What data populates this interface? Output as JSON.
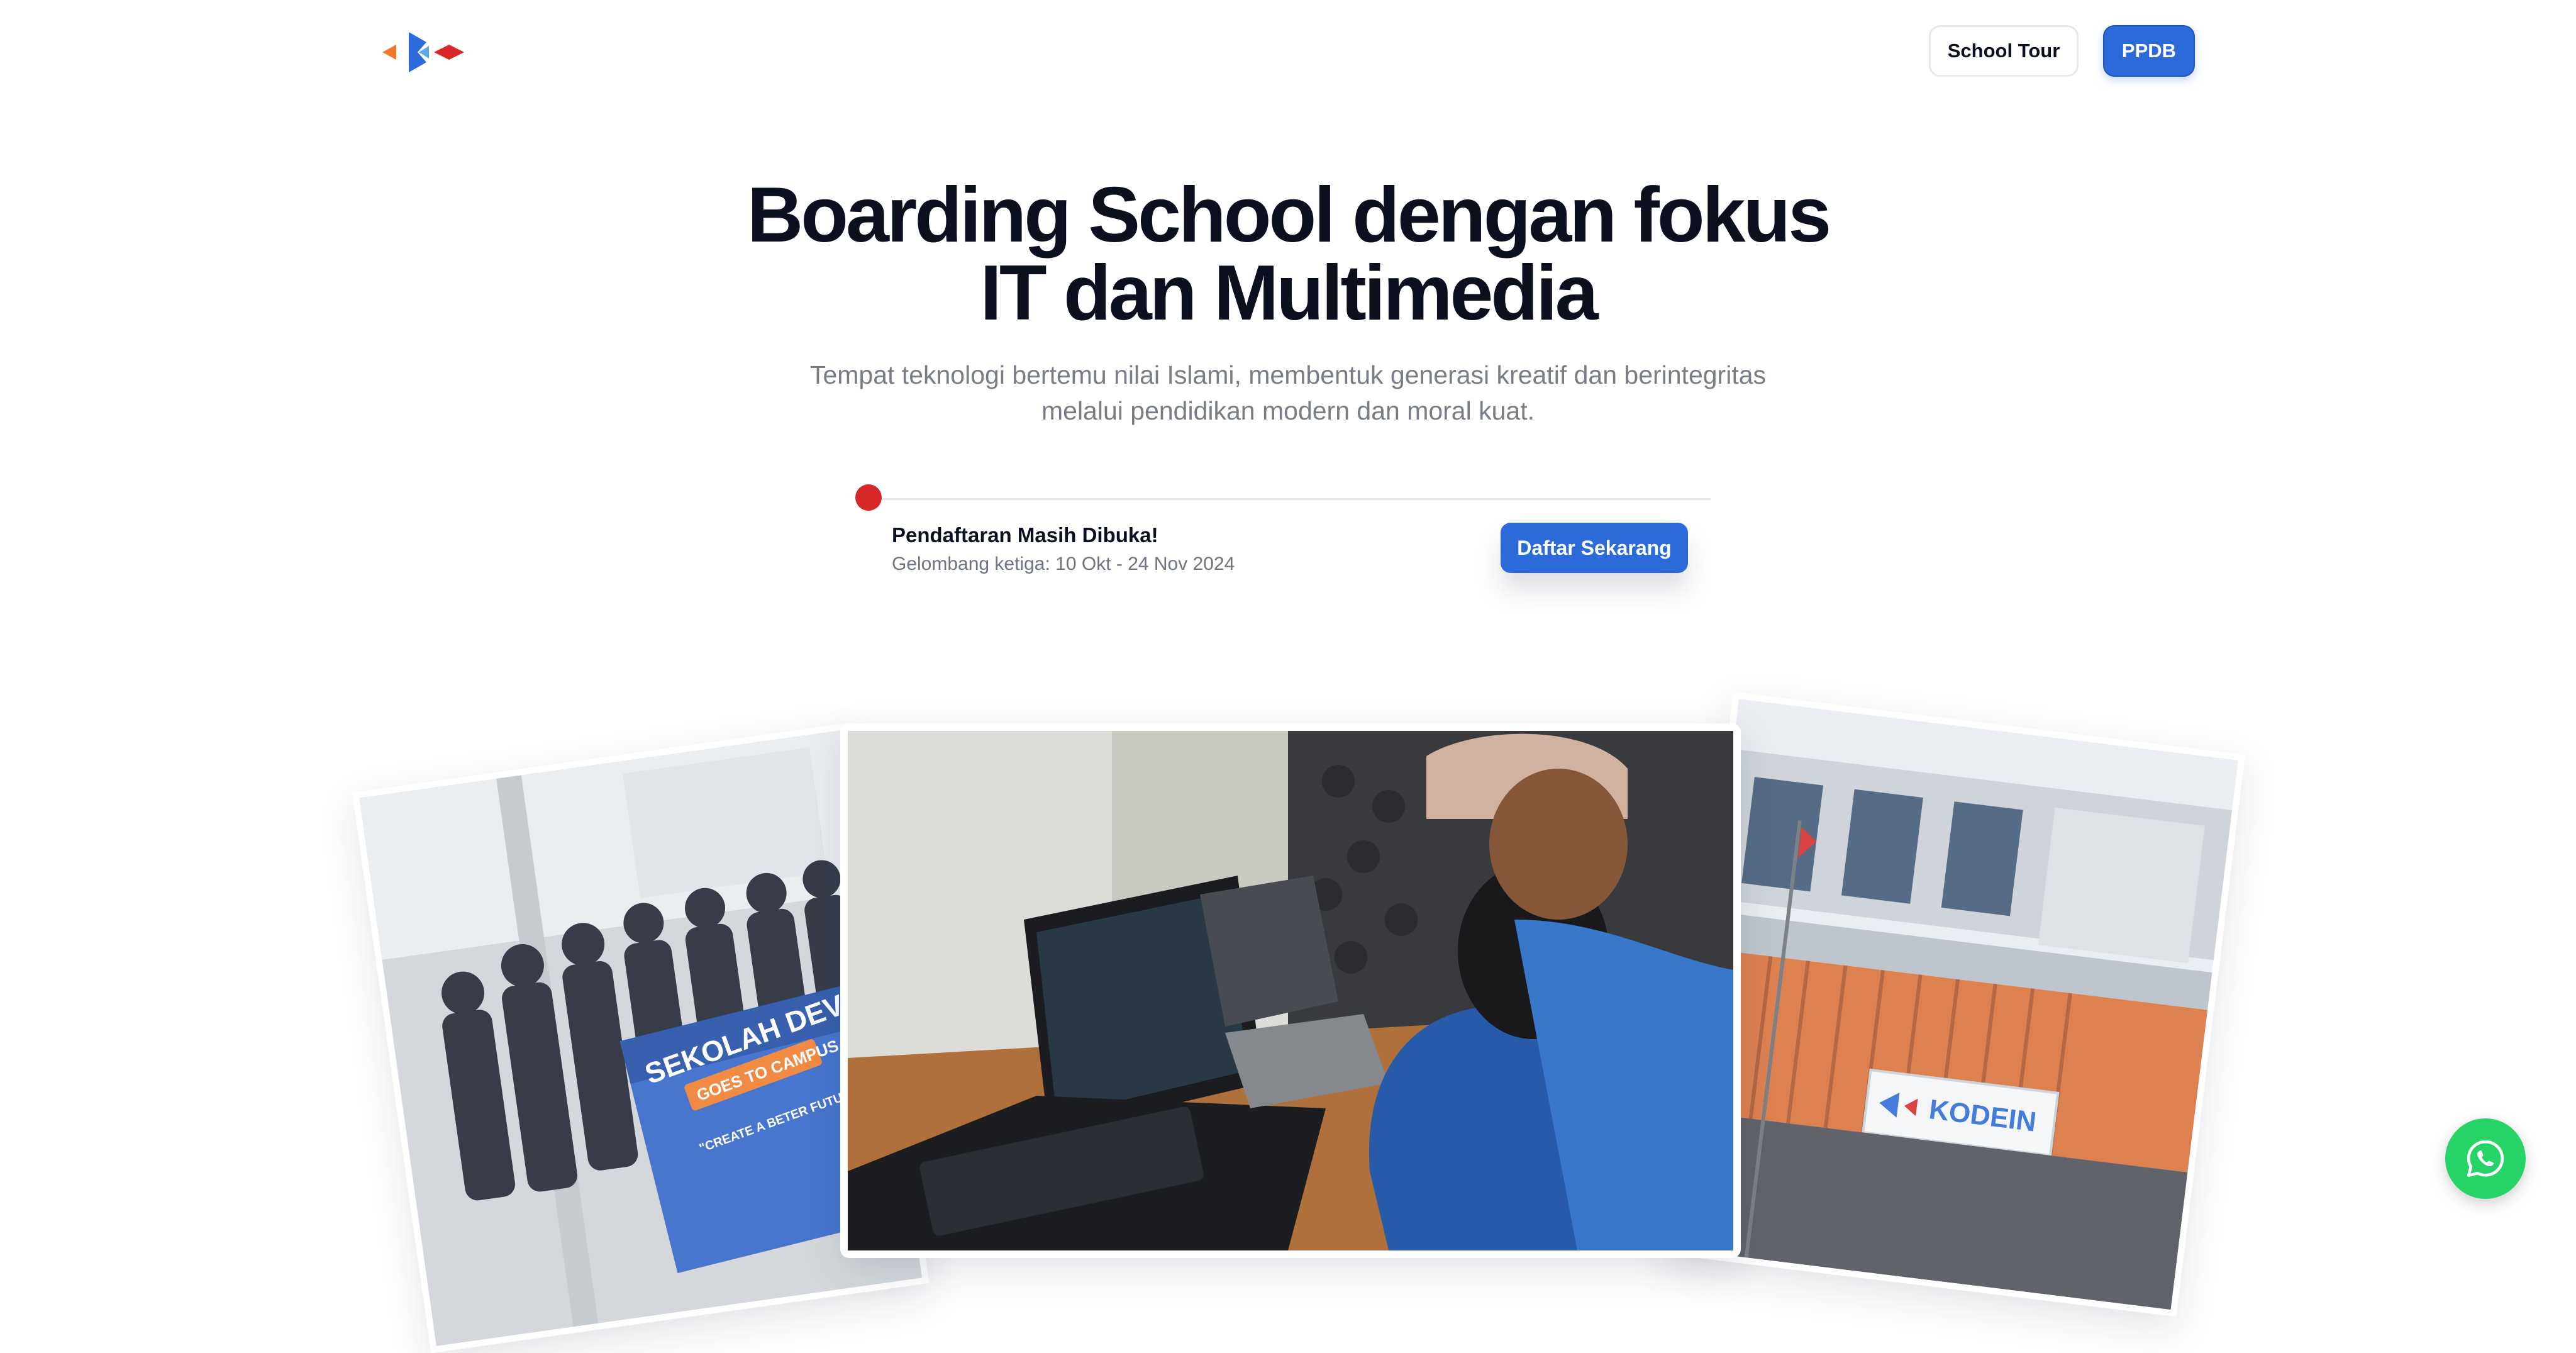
{
  "header": {
    "tour_label": "School Tour",
    "ppdb_label": "PPDB"
  },
  "hero": {
    "title_line1": "Boarding School dengan fokus",
    "title_line2": "IT dan Multimedia",
    "subtitle_line1": "Tempat teknologi bertemu nilai Islami, membentuk generasi kreatif dan berintegritas",
    "subtitle_line2": "melalui pendidikan modern dan moral kuat."
  },
  "notice": {
    "title": "Pendaftaran Masih Dibuka!",
    "period": "Gelombang ketiga: 10 Okt - 24 Nov 2024",
    "cta_label": "Daftar Sekarang"
  },
  "photos": {
    "left": {
      "banner_title": "SEKOLAH DEVELOPER IN",
      "banner_sub": "GOES TO CAMPUS",
      "banner_quote": "\"CREATE A BETER FUTURE WITH TECHNOLOGY\""
    },
    "right": {
      "sign_text": "KODEIN"
    }
  },
  "colors": {
    "primary": "#2b6ad8",
    "notice_dot": "#d62828",
    "whatsapp": "#25d366"
  },
  "icons": {
    "logo": "kodein-logo",
    "whatsapp": "whatsapp-icon"
  }
}
